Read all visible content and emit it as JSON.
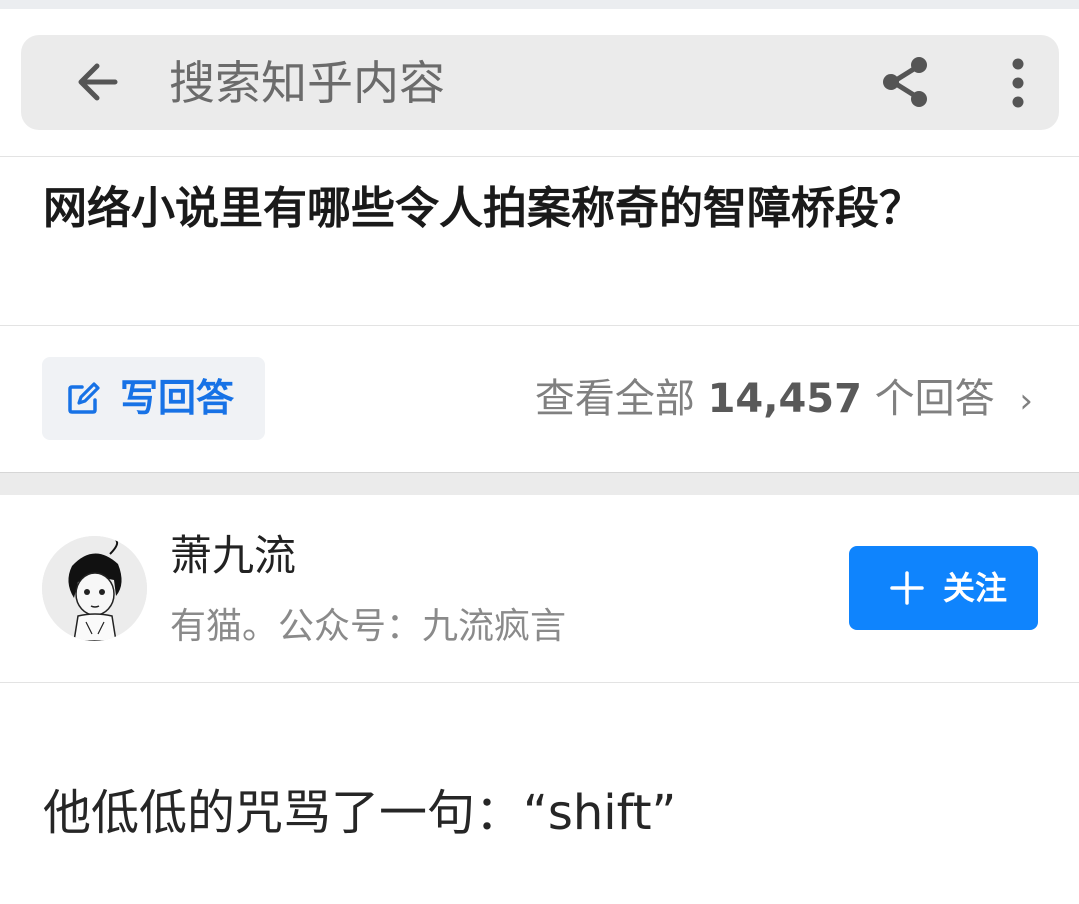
{
  "search": {
    "placeholder": "搜索知乎内容",
    "back_icon": "arrow-left-icon",
    "share_icon": "share-icon",
    "more_icon": "more-vertical-icon"
  },
  "question": {
    "title": "网络小说里有哪些令人拍案称奇的智障桥段？"
  },
  "actions": {
    "write_label": "写回答",
    "write_icon": "edit-icon",
    "view_all_prefix": "查看全部",
    "answer_count": "14,457",
    "view_all_suffix": "个回答",
    "chevron": "›"
  },
  "author": {
    "name": "萧九流",
    "bio": "有猫。公众号：九流疯言",
    "follow_label": "关注",
    "follow_icon": "plus-icon"
  },
  "answer": {
    "first_line": "他低低的咒骂了一句：“shift”"
  },
  "colors": {
    "accent_blue": "#1772e6",
    "follow_blue": "#0f84fd",
    "search_bg": "#ebebeb"
  }
}
